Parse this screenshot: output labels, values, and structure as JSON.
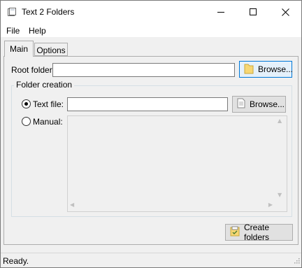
{
  "window": {
    "title": "Text 2 Folders",
    "controls": [
      "minimize-icon",
      "maximize-icon",
      "close-icon"
    ]
  },
  "menu": {
    "file": "File",
    "help": "Help"
  },
  "tabs": {
    "main": "Main",
    "options": "Options",
    "active": "Main"
  },
  "main": {
    "root_folder_label": "Root folder:",
    "root_folder_value": "",
    "root_browse_label": "Browse...",
    "root_browse_icon": "folder-icon",
    "folder_creation_title": "Folder creation",
    "text_file_label": "Text file:",
    "text_file_value": "",
    "text_file_selected": true,
    "text_browse_label": "Browse...",
    "text_browse_icon": "document-icon",
    "manual_label": "Manual:",
    "manual_value": "",
    "create_folders_label": "Create folders",
    "create_folders_icon": "checklist-icon"
  },
  "status": {
    "text": "Ready."
  },
  "colors": {
    "window_bg": "#f0f0f0",
    "focus_border": "#0078d7",
    "focus_bg": "#e5f1fb"
  }
}
